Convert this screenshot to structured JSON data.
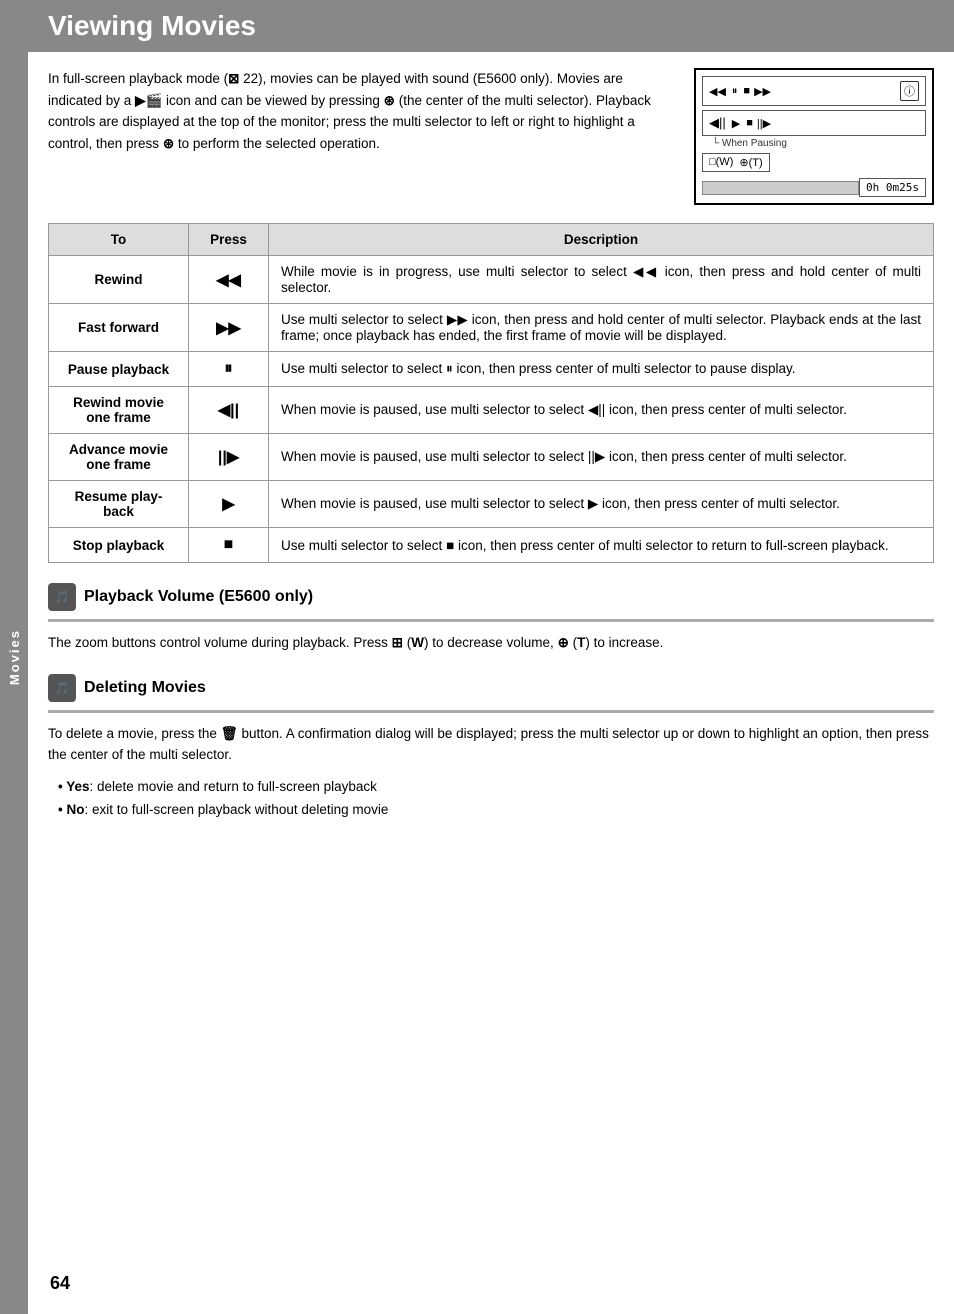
{
  "page": {
    "title": "Viewing Movies",
    "page_number": "64",
    "side_tab_label": "Movies"
  },
  "intro": {
    "text": "In full-screen playback mode (⊠ 22), movies can be played with sound (E5600 only). Movies are indicated by a ▶🎬 icon and can be viewed by pressing ⊛ (the center of the multi selector). Playback controls are displayed at the top of the monitor; press the multi selector to left or right to highlight a control, then press ⊛ to perform the selected operation."
  },
  "table": {
    "headers": [
      "To",
      "Press",
      "Description"
    ],
    "rows": [
      {
        "to": "Rewind",
        "press": "◀◀",
        "description": "While movie is in progress, use multi selector to select ◀◀ icon, then press and hold center of multi selector."
      },
      {
        "to": "Fast forward",
        "press": "▶▶",
        "description": "Use multi selector to select ▶▶ icon, then press and hold center of multi selector. Playback ends at the last frame; once playback has ended, the first frame of movie will be displayed."
      },
      {
        "to": "Pause playback",
        "press": "⏸",
        "description": "Use multi selector to select ⏸ icon, then press center of multi selector to pause display."
      },
      {
        "to": "Rewind movie\none frame",
        "press": "◀||",
        "description": "When movie is paused, use multi selector to select ◀|| icon, then press center of multi selector."
      },
      {
        "to": "Advance movie\none frame",
        "press": "||▶",
        "description": "When movie is paused, use multi selector to select ||▶ icon, then press center of multi selector."
      },
      {
        "to": "Resume play-\nback",
        "press": "▶",
        "description": "When movie is paused, use multi selector to select ▶ icon, then press center of multi selector."
      },
      {
        "to": "Stop playback",
        "press": "■",
        "description": "Use multi selector to select ■ icon, then press center of multi selector to return to full-screen playback."
      }
    ]
  },
  "section_playback_volume": {
    "title": "Playback Volume (E5600 only)",
    "text": "The zoom buttons control volume during playback. Press 🔲 (W) to decrease volume, 🔍 (T) to increase."
  },
  "section_deleting_movies": {
    "title": "Deleting Movies",
    "text": "To delete a movie, press the 🗑 button. A confirmation dialog will be displayed; press the multi selector up or down to highlight an option, then press the center of the multi selector.",
    "bullets": [
      "Yes: delete movie and return to full-screen playback",
      "No: exit to full-screen playback without deleting movie"
    ]
  },
  "camera_preview": {
    "time": "0h 0m25s",
    "when_pausing": "When Pausing"
  }
}
